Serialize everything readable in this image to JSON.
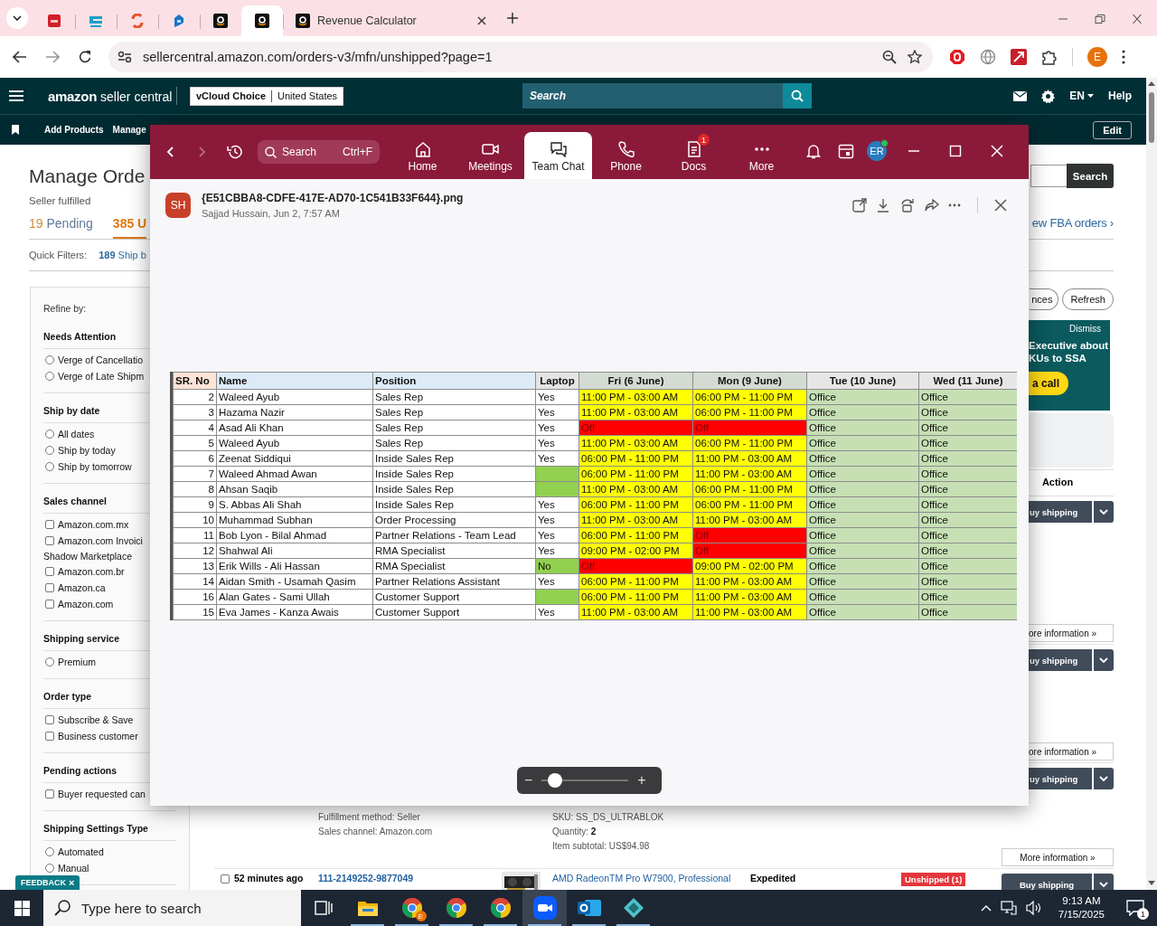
{
  "browser": {
    "tabs": [
      {
        "selected": false
      },
      {
        "selected": false
      },
      {
        "selected": false
      },
      {
        "selected": false
      },
      {
        "selected": false
      },
      {
        "selected": true
      },
      {
        "title": "Revenue Calculator",
        "selected": false
      }
    ],
    "url": "sellercentral.amazon.com/orders-v3/mfn/unshipped?page=1",
    "profile": "E"
  },
  "seller_header": {
    "logo_word": "amazon",
    "logo_product": "seller central",
    "store": "vCloud Choice",
    "marketplace": "United States",
    "search_placeholder": "Search",
    "language": "EN",
    "help": "Help"
  },
  "nav": {
    "items": [
      "Add Products",
      "Manage"
    ],
    "edit": "Edit"
  },
  "page": {
    "title": "Manage Orde",
    "subtitle": "Seller fulfilled",
    "search_button": "Search",
    "tabs": [
      {
        "count": "19",
        "label": "Pending",
        "selected": false
      },
      {
        "count": "385",
        "label": "U",
        "selected": true
      }
    ],
    "fba_link": "ew FBA orders ›",
    "quick_filters": {
      "label": "Quick Filters:",
      "count": "189",
      "text": "Ship b"
    },
    "refine": {
      "title": "Refine by:",
      "sections": [
        {
          "title": "Needs Attention",
          "options": [
            {
              "kind": "radio",
              "label": "Verge of Cancellatio",
              "checked": false
            },
            {
              "kind": "radio",
              "label": "Verge of Late Shipm",
              "checked": false
            }
          ]
        },
        {
          "title": "Ship by date",
          "options": [
            {
              "kind": "radio",
              "label": "All dates",
              "checked": false
            },
            {
              "kind": "radio",
              "label": "Ship by today",
              "checked": false
            },
            {
              "kind": "radio",
              "label": "Ship by tomorrow",
              "checked": false
            }
          ]
        },
        {
          "title": "Sales channel",
          "options": [
            {
              "kind": "checkbox",
              "label": "Amazon.com.mx",
              "checked": false
            },
            {
              "kind": "checkbox",
              "label": "Amazon.com Invoici",
              "label_2": "Shadow Marketplace",
              "checked": false
            },
            {
              "kind": "checkbox",
              "label": "Amazon.com.br",
              "checked": false
            },
            {
              "kind": "checkbox",
              "label": "Amazon.ca",
              "checked": false
            },
            {
              "kind": "checkbox",
              "label": "Amazon.com",
              "checked": false
            }
          ]
        },
        {
          "title": "Shipping service",
          "options": [
            {
              "kind": "radio",
              "label": "Premium",
              "checked": false
            }
          ]
        },
        {
          "title": "Order type",
          "options": [
            {
              "kind": "checkbox",
              "label": "Subscribe & Save",
              "checked": false
            },
            {
              "kind": "checkbox",
              "label": "Business customer",
              "checked": false
            }
          ]
        },
        {
          "title": "Pending actions",
          "options": [
            {
              "kind": "checkbox",
              "label": "Buyer requested can",
              "checked": false
            }
          ]
        },
        {
          "title": "Shipping Settings Type",
          "options": [
            {
              "kind": "radio",
              "label": "Automated",
              "checked": false
            },
            {
              "kind": "radio",
              "label": "Manual",
              "checked": false
            }
          ]
        }
      ]
    },
    "toolbar": [
      "nces",
      "Refresh"
    ],
    "banner": {
      "dismiss": "Dismiss",
      "lines": [
        "Executive about",
        "KUs to SSA"
      ],
      "cta": "a call"
    },
    "orders": {
      "action_header": "Action",
      "rows": [
        {
          "buy": "uy shipping",
          "more": "ore information »"
        },
        {
          "buy": "uy shipping",
          "more": "ore information »"
        },
        {
          "buy": "uy shipping",
          "fulfillment": "Fulfillment method: Seller",
          "channel": "Sales channel: Amazon.com",
          "sku": "SKU: SS_DS_ULTRABLOK",
          "quantity": "Quantity: **2**",
          "subtotal": "Item subtotal: US$94.98",
          "more": "More information »"
        },
        {
          "checked": false,
          "age": "52 minutes ago",
          "order_id": "111-2149252-9877049",
          "product": "AMD RadeonTM Pro W7900, Professional",
          "service": "Expedited",
          "status": "Unshipped (1)",
          "buy": "Buy shipping"
        }
      ]
    },
    "feedback": {
      "label": "FEEDBACK",
      "close": "×"
    }
  },
  "zoom_app": {
    "search": "Search",
    "shortcut": "Ctrl+F",
    "tabs": [
      {
        "label": "Home",
        "selected": false
      },
      {
        "label": "Meetings",
        "selected": false
      },
      {
        "label": "Team Chat",
        "selected": true
      },
      {
        "label": "Phone",
        "selected": false
      },
      {
        "label": "Docs",
        "badge": "1",
        "selected": false
      },
      {
        "label": "More",
        "selected": false
      }
    ],
    "avatar": "ER",
    "online": true,
    "file": {
      "avatar": "SH",
      "name": "{E51CBBA8-CDFE-417E-AD70-1C541B33F644}.png",
      "meta": "Sajjad Hussain, Jun 2, 7:57 AM"
    },
    "sheet": {
      "columns": [
        {
          "label": "SR. No",
          "color": "#fce4d6"
        },
        {
          "label": "Name",
          "color": "#ddebf7"
        },
        {
          "label": "Position",
          "color": "#ddebf7"
        },
        {
          "label": "Laptop",
          "color": "#e4e4e4"
        },
        {
          "label": "Fri (6 June)",
          "color": "#d4dbd2"
        },
        {
          "label": "Mon (9 June)",
          "color": "#d4dbd2"
        },
        {
          "label": "Tue (10 June)",
          "color": "#e7e6e6"
        },
        {
          "label": "Wed (11 June)",
          "color": "#e7e6e6"
        }
      ],
      "rows": [
        {
          "sr": "2",
          "name": "Waleed Ayub",
          "position": "Sales Rep",
          "laptop": {
            "text": "Yes"
          },
          "days": [
            {
              "text": "11:00 PM - 03:00 AM",
              "color": "#ffff00"
            },
            {
              "text": "06:00 PM - 11:00 PM",
              "color": "#ffff00"
            },
            {
              "text": "Office",
              "color": "#c6e0b4"
            },
            {
              "text": "Office",
              "color": "#c6e0b4"
            }
          ]
        },
        {
          "sr": "3",
          "name": "Hazama Nazir",
          "position": "Sales Rep",
          "laptop": {
            "text": "Yes"
          },
          "days": [
            {
              "text": "11:00 PM - 03:00 AM",
              "color": "#ffff00"
            },
            {
              "text": "06:00 PM - 11:00 PM",
              "color": "#ffff00"
            },
            {
              "text": "Office",
              "color": "#c6e0b4"
            },
            {
              "text": "Office",
              "color": "#c6e0b4"
            }
          ]
        },
        {
          "sr": "4",
          "name": "Asad Ali Khan",
          "position": "Sales Rep",
          "laptop": {
            "text": "Yes"
          },
          "days": [
            {
              "text": "Off",
              "color": "#ff0000"
            },
            {
              "text": "Off",
              "color": "#ff0000"
            },
            {
              "text": "Office",
              "color": "#c6e0b4"
            },
            {
              "text": "Office",
              "color": "#c6e0b4"
            }
          ]
        },
        {
          "sr": "5",
          "name": "Waleed Ayub",
          "position": "Sales Rep",
          "laptop": {
            "text": "Yes"
          },
          "days": [
            {
              "text": "11:00 PM - 03:00 AM",
              "color": "#ffff00"
            },
            {
              "text": "06:00 PM - 11:00 PM",
              "color": "#ffff00"
            },
            {
              "text": "Office",
              "color": "#c6e0b4"
            },
            {
              "text": "Office",
              "color": "#c6e0b4"
            }
          ]
        },
        {
          "sr": "6",
          "name": "Zeenat Siddiqui",
          "position": "Inside Sales Rep",
          "laptop": {
            "text": "Yes"
          },
          "days": [
            {
              "text": "06:00 PM - 11:00 PM",
              "color": "#ffff00"
            },
            {
              "text": "11:00 PM - 03:00 AM",
              "color": "#ffff00"
            },
            {
              "text": "Office",
              "color": "#c6e0b4"
            },
            {
              "text": "Office",
              "color": "#c6e0b4"
            }
          ]
        },
        {
          "sr": "7",
          "name": "Waleed Ahmad Awan",
          "position": "Inside Sales Rep",
          "laptop": {
            "color": "#92d050"
          },
          "days": [
            {
              "text": "06:00 PM - 11:00 PM",
              "color": "#ffff00"
            },
            {
              "text": "11:00 PM - 03:00 AM",
              "color": "#ffff00"
            },
            {
              "text": "Office",
              "color": "#c6e0b4"
            },
            {
              "text": "Office",
              "color": "#c6e0b4"
            }
          ]
        },
        {
          "sr": "8",
          "name": "Ahsan Saqib",
          "position": "Inside Sales Rep",
          "laptop": {
            "color": "#92d050"
          },
          "days": [
            {
              "text": "11:00 PM - 03:00 AM",
              "color": "#ffff00"
            },
            {
              "text": "06:00 PM - 11:00 PM",
              "color": "#ffff00"
            },
            {
              "text": "Office",
              "color": "#c6e0b4"
            },
            {
              "text": "Office",
              "color": "#c6e0b4"
            }
          ]
        },
        {
          "sr": "9",
          "name": "S. Abbas Ali Shah",
          "position": "Inside Sales Rep",
          "laptop": {
            "text": "Yes"
          },
          "days": [
            {
              "text": "06:00 PM - 11:00 PM",
              "color": "#ffff00"
            },
            {
              "text": "06:00 PM - 11:00 PM",
              "color": "#ffff00"
            },
            {
              "text": "Office",
              "color": "#c6e0b4"
            },
            {
              "text": "Office",
              "color": "#c6e0b4"
            }
          ]
        },
        {
          "sr": "10",
          "name": "Muhammad Subhan",
          "position": "Order Processing",
          "laptop": {
            "text": "Yes"
          },
          "days": [
            {
              "text": "11:00 PM - 03:00 AM",
              "color": "#ffff00"
            },
            {
              "text": "11:00 PM - 03:00 AM",
              "color": "#ffff00"
            },
            {
              "text": "Office",
              "color": "#c6e0b4"
            },
            {
              "text": "Office",
              "color": "#c6e0b4"
            }
          ]
        },
        {
          "sr": "11",
          "name": "Bob Lyon - Bilal Ahmad",
          "position": "Partner Relations - Team Lead",
          "laptop": {
            "text": "Yes"
          },
          "days": [
            {
              "text": "06:00 PM - 11:00 PM",
              "color": "#ffff00"
            },
            {
              "text": "Off",
              "color": "#ff0000"
            },
            {
              "text": "Office",
              "color": "#c6e0b4"
            },
            {
              "text": "Office",
              "color": "#c6e0b4"
            }
          ]
        },
        {
          "sr": "12",
          "name": "Shahwal Ali",
          "position": "RMA Specialist",
          "laptop": {
            "text": "Yes"
          },
          "days": [
            {
              "text": "09:00 PM - 02:00 PM",
              "color": "#ffff00"
            },
            {
              "text": "Off",
              "color": "#ff0000"
            },
            {
              "text": "Office",
              "color": "#c6e0b4"
            },
            {
              "text": "Office",
              "color": "#c6e0b4"
            }
          ]
        },
        {
          "sr": "13",
          "name": "Erik Wills - Ali Hassan",
          "position": "RMA Specialist",
          "laptop": {
            "text": "No",
            "color": "#92d050"
          },
          "days": [
            {
              "text": "Off",
              "color": "#ff0000"
            },
            {
              "text": "09:00 PM - 02:00 PM",
              "color": "#ffff00"
            },
            {
              "text": "Office",
              "color": "#c6e0b4"
            },
            {
              "text": "Office",
              "color": "#c6e0b4"
            }
          ]
        },
        {
          "sr": "14",
          "name": "Aidan Smith - Usamah Qasim",
          "position": "Partner Relations Assistant",
          "laptop": {
            "text": "Yes"
          },
          "days": [
            {
              "text": "06:00 PM - 11:00 PM",
              "color": "#ffff00"
            },
            {
              "text": "11:00 PM - 03:00 AM",
              "color": "#ffff00"
            },
            {
              "text": "Office",
              "color": "#c6e0b4"
            },
            {
              "text": "Office",
              "color": "#c6e0b4"
            }
          ]
        },
        {
          "sr": "16",
          "name": "Alan Gates - Sami Ullah",
          "position": "Customer Support",
          "laptop": {
            "color": "#92d050"
          },
          "days": [
            {
              "text": "06:00 PM - 11:00 PM",
              "color": "#ffff00"
            },
            {
              "text": "11:00 PM - 03:00 AM",
              "color": "#ffff00"
            },
            {
              "text": "Office",
              "color": "#c6e0b4"
            },
            {
              "text": "Office",
              "color": "#c6e0b4"
            }
          ]
        },
        {
          "sr": "15",
          "name": "Eva James - Kanza Awais",
          "position": "Customer Support",
          "laptop": {
            "text": "Yes"
          },
          "days": [
            {
              "text": "11:00 PM - 03:00 AM",
              "color": "#ffff00"
            },
            {
              "text": "11:00 PM - 03:00 AM",
              "color": "#ffff00"
            },
            {
              "text": "Office",
              "color": "#c6e0b4"
            },
            {
              "text": "Office",
              "color": "#c6e0b4"
            }
          ]
        }
      ]
    },
    "zoom_control": {
      "minus": "−",
      "plus": "+",
      "level": 0.15
    }
  },
  "taskbar": {
    "search_placeholder": "Type here to search",
    "apps": [
      {
        "running": false,
        "active": false
      },
      {
        "running": true,
        "active": false
      },
      {
        "badge": "E",
        "running": true,
        "active": false
      },
      {
        "running": true,
        "active": false
      },
      {
        "running": true,
        "active": false
      },
      {
        "running": true,
        "active": true
      },
      {
        "running": true,
        "active": false
      },
      {
        "running": true,
        "active": false
      }
    ],
    "time": "9:13 AM",
    "date": "7/15/2025",
    "notifications": "1"
  }
}
